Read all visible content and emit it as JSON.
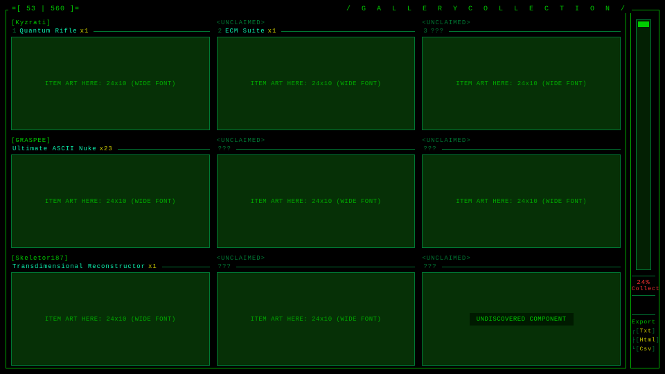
{
  "header": {
    "counter": "=[ 53 | 560 ]=",
    "title": "/ G A L L E R Y   C O L L E C T I O N /"
  },
  "cards": [
    {
      "author": "[Kyzrati]",
      "claimed": true,
      "num": "1",
      "name": "Quantum Rifle",
      "unknown": false,
      "count": "x1",
      "art": "ITEM ART HERE: 24x10 (WIDE FONT)"
    },
    {
      "author": "<UNCLAIMED>",
      "claimed": false,
      "num": "2",
      "name": "ECM Suite",
      "unknown": false,
      "count": "x1",
      "art": "ITEM ART HERE: 24x10 (WIDE FONT)"
    },
    {
      "author": "<UNCLAIMED>",
      "claimed": false,
      "num": "3",
      "name": "???",
      "unknown": true,
      "count": "",
      "art": "ITEM ART HERE: 24x10 (WIDE FONT)"
    },
    {
      "author": "[GRASPEE]",
      "claimed": true,
      "num": "",
      "name": "Ultimate ASCII Nuke",
      "unknown": false,
      "count": "x23",
      "art": "ITEM ART HERE: 24x10 (WIDE FONT)"
    },
    {
      "author": "<UNCLAIMED>",
      "claimed": false,
      "num": "",
      "name": "???",
      "unknown": true,
      "count": "",
      "art": "ITEM ART HERE: 24x10 (WIDE FONT)"
    },
    {
      "author": "<UNCLAIMED>",
      "claimed": false,
      "num": "",
      "name": "???",
      "unknown": true,
      "count": "",
      "art": "ITEM ART HERE: 24x10 (WIDE FONT)"
    },
    {
      "author": "[Skeletor187]",
      "claimed": true,
      "num": "",
      "name": "Transdimensional Reconstructor",
      "unknown": false,
      "count": "x1",
      "art": "ITEM ART HERE: 24x10 (WIDE FONT)"
    },
    {
      "author": "<UNCLAIMED>",
      "claimed": false,
      "num": "",
      "name": "???",
      "unknown": true,
      "count": "",
      "art": "ITEM ART HERE: 24x10 (WIDE FONT)"
    },
    {
      "author": "<UNCLAIMED>",
      "claimed": false,
      "num": "",
      "name": "???",
      "unknown": true,
      "count": "",
      "art": "",
      "undiscovered": "UNDISCOVERED COMPONENT"
    }
  ],
  "side": {
    "percent": "24%",
    "collect": "Collect",
    "export": "Export",
    "opts": [
      "Txt",
      "Html",
      "Csv"
    ]
  }
}
